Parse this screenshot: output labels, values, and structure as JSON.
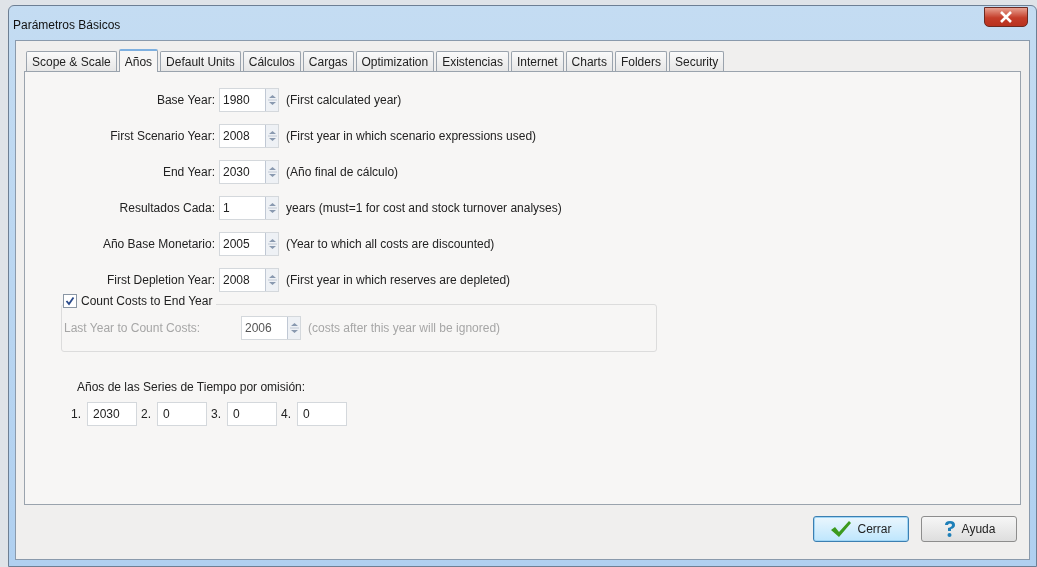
{
  "window": {
    "title": "Parámetros Básicos"
  },
  "tabs": [
    {
      "label": "Scope & Scale",
      "selected": false
    },
    {
      "label": "Años",
      "selected": true
    },
    {
      "label": "Default Units",
      "selected": false
    },
    {
      "label": "Cálculos",
      "selected": false
    },
    {
      "label": "Cargas",
      "selected": false
    },
    {
      "label": "Optimization",
      "selected": false
    },
    {
      "label": "Existencias",
      "selected": false
    },
    {
      "label": "Internet",
      "selected": false
    },
    {
      "label": "Charts",
      "selected": false
    },
    {
      "label": "Folders",
      "selected": false
    },
    {
      "label": "Security",
      "selected": false
    }
  ],
  "fields": [
    {
      "label": "Base Year:",
      "value": "1980",
      "note": "(First calculated year)"
    },
    {
      "label": "First Scenario Year:",
      "value": "2008",
      "note": "(First year in which scenario expressions used)"
    },
    {
      "label": "End Year:",
      "value": "2030",
      "note": "(Año final de cálculo)"
    },
    {
      "label": "Resultados Cada:",
      "value": "1",
      "note": "years (must=1 for cost and stock turnover analyses)"
    },
    {
      "label": "Año Base Monetario:",
      "value": "2005",
      "note": "(Year to which all costs are  discounted)"
    },
    {
      "label": "First Depletion Year:",
      "value": "2008",
      "note": "(First year in which reserves are depleted)"
    }
  ],
  "count_costs": {
    "label": "Count Costs to End Year",
    "checked": true,
    "field": {
      "label": "Last Year to Count Costs:",
      "value": "2006",
      "note": "(costs after this year will be ignored)",
      "disabled": true
    }
  },
  "series_years": {
    "label": "Años de las Series de Tiempo por omisión:",
    "items": [
      {
        "index": "1.",
        "value": "2030"
      },
      {
        "index": "2.",
        "value": "0"
      },
      {
        "index": "3.",
        "value": "0"
      },
      {
        "index": "4.",
        "value": "0"
      }
    ]
  },
  "buttons": [
    {
      "label": "Cerrar",
      "kind": "close",
      "focused": true
    },
    {
      "label": "Ayuda",
      "kind": "help",
      "focused": false
    }
  ]
}
